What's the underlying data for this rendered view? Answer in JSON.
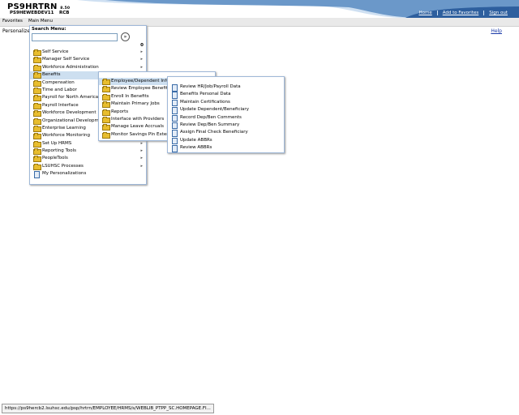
{
  "header": {
    "app_title": "PS9HRTRN",
    "app_version": "8.50",
    "db_name": "PS9HEWEBDEV11",
    "user_code": "RCB",
    "links": [
      "Home",
      "Add to Favorites",
      "Sign out"
    ],
    "accent_color": "#2e5f9e"
  },
  "menubar": {
    "favorites": "Favorites",
    "main_menu": "Main Menu"
  },
  "page": {
    "personalize_text": "Personalize",
    "help_link": "Help"
  },
  "search_menu": {
    "label": "Search Menu:",
    "input_value": "",
    "go_icon": "go-arrow-icon",
    "count": "0"
  },
  "main_menu_items": [
    {
      "label": "Self Service",
      "icon": "folder-icon",
      "submenu": true
    },
    {
      "label": "Manager Self Service",
      "icon": "folder-icon",
      "submenu": true
    },
    {
      "label": "Workforce Administration",
      "icon": "folder-icon",
      "submenu": true
    },
    {
      "label": "Benefits",
      "icon": "folder-icon",
      "submenu": true,
      "active": true
    },
    {
      "label": "Compensation",
      "icon": "folder-icon",
      "submenu": true
    },
    {
      "label": "Time and Labor",
      "icon": "folder-icon",
      "submenu": true
    },
    {
      "label": "Payroll for North America",
      "icon": "folder-icon",
      "submenu": true
    },
    {
      "label": "Payroll Interface",
      "icon": "folder-icon",
      "submenu": true
    },
    {
      "label": "Workforce Development",
      "icon": "folder-icon",
      "submenu": true
    },
    {
      "label": "Organizational Development",
      "icon": "folder-icon",
      "submenu": true
    },
    {
      "label": "Enterprise Learning",
      "icon": "folder-icon",
      "submenu": true
    },
    {
      "label": "Workforce Monitoring",
      "icon": "folder-icon",
      "submenu": true
    },
    {
      "label": "Set Up HRMS",
      "icon": "folder-icon",
      "submenu": true
    },
    {
      "label": "Reporting Tools",
      "icon": "folder-icon",
      "submenu": true
    },
    {
      "label": "PeopleTools",
      "icon": "folder-icon",
      "submenu": true
    },
    {
      "label": "LSUHSC Processes",
      "icon": "folder-icon",
      "submenu": true
    },
    {
      "label": "My Personalizations",
      "icon": "document-icon",
      "submenu": false
    }
  ],
  "benefits_menu_items": [
    {
      "label": "Employee/Dependent Information",
      "icon": "folder-icon",
      "active": true
    },
    {
      "label": "Review Employee Benefits",
      "icon": "folder-icon"
    },
    {
      "label": "Enroll In Benefits",
      "icon": "folder-icon"
    },
    {
      "label": "Maintain Primary Jobs",
      "icon": "folder-icon"
    },
    {
      "label": "Reports",
      "icon": "folder-icon"
    },
    {
      "label": "Interface with Providers",
      "icon": "folder-icon"
    },
    {
      "label": "Manage Leave Accruals",
      "icon": "folder-icon"
    },
    {
      "label": "Monitor Savings Pln Extensions",
      "icon": "folder-icon"
    }
  ],
  "employee_menu_items": [
    {
      "label": "Review HR/Job/Payroll Data",
      "icon": "document-icon"
    },
    {
      "label": "Benefits Personal Data",
      "icon": "document-icon"
    },
    {
      "label": "Maintain Certifications",
      "icon": "document-icon"
    },
    {
      "label": "Update Dependent/Beneficiary",
      "icon": "document-icon"
    },
    {
      "label": "Record Dep/Ben Comments",
      "icon": "document-icon"
    },
    {
      "label": "Review Dep/Ben Summary",
      "icon": "document-icon"
    },
    {
      "label": "Assign Final Check Beneficiary",
      "icon": "document-icon"
    },
    {
      "label": "Update ABBRs",
      "icon": "document-icon"
    },
    {
      "label": "Review ABBRs",
      "icon": "document-icon"
    }
  ],
  "statusbar": {
    "url": "https://ps9hercb2.lsuhsc.edu/psp/hrtrn/EMPLOYEE/HRMS/s/WEBLIB_PTPP_SC.HOMEPAGE.FI..."
  }
}
